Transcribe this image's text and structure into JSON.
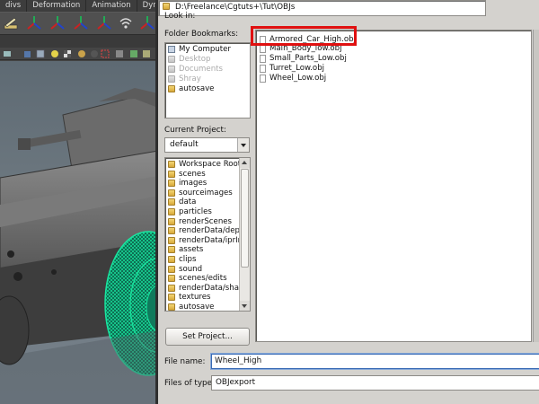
{
  "maya": {
    "menubar": [
      "divs",
      "Deformation",
      "Animation",
      "Dyn"
    ],
    "viewport_desc": "3D armored car wireframe"
  },
  "dialog": {
    "look_in_label": "Look in:",
    "look_in_path": "D:\\Freelance\\Cgtuts+\\Tut\\OBJs",
    "bookmarks_label": "Folder Bookmarks:",
    "bookmarks": [
      "My Computer",
      "Desktop",
      "Documents",
      "Shray",
      "autosave"
    ],
    "current_project_label": "Current Project:",
    "current_project": "default",
    "project_folders": [
      "Workspace Root",
      "scenes",
      "images",
      "sourceimages",
      "data",
      "particles",
      "renderScenes",
      "renderData/depth",
      "renderData/iprIm",
      "assets",
      "clips",
      "sound",
      "scenes/edits",
      "renderData/shad",
      "textures",
      "autosave"
    ],
    "set_project_label": "Set Project...",
    "files": [
      "Armored_Car_High.obj",
      "Main_Body_low.obj",
      "Small_Parts_Low.obj",
      "Turret_Low.obj",
      "Wheel_Low.obj"
    ],
    "file_name_label": "File name:",
    "file_name_value": "Wheel_High",
    "file_type_label": "Files of type:",
    "file_type_value": "OBJexport"
  },
  "colors": {
    "highlight": "#e01010",
    "wireframe": "#19e6a0",
    "dialog_bg": "#d4d2ce"
  }
}
